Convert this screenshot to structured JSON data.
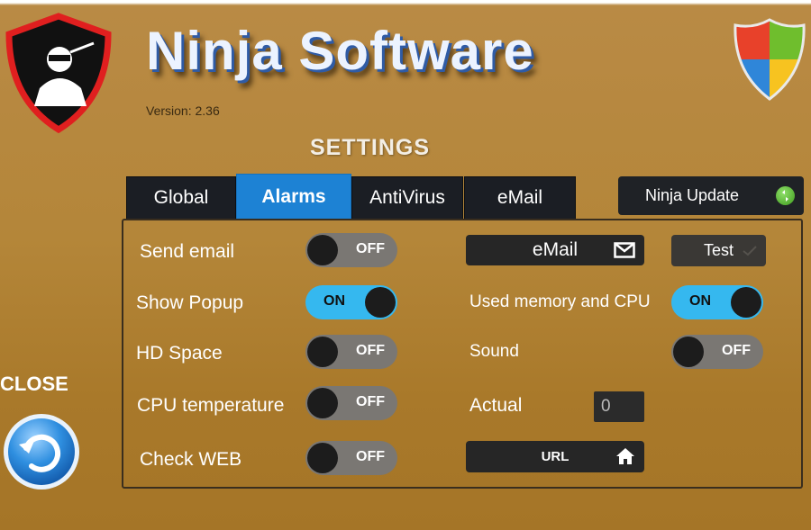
{
  "app": {
    "title": "Ninja Software",
    "version": "Version: 2.36",
    "settings_heading": "SETTINGS"
  },
  "tabs": [
    {
      "label": "Global",
      "active": false
    },
    {
      "label": "Alarms",
      "active": true
    },
    {
      "label": "AntiVirus",
      "active": false
    },
    {
      "label": "eMail",
      "active": false
    }
  ],
  "update_button": {
    "label": "Ninja Update",
    "icon": "refresh-icon"
  },
  "alarms": {
    "send_email": {
      "label": "Send email",
      "state": "OFF"
    },
    "show_popup": {
      "label": "Show Popup",
      "state": "ON"
    },
    "hd_space": {
      "label": "HD Space",
      "state": "OFF"
    },
    "cpu_temperature": {
      "label": "CPU temperature",
      "state": "OFF"
    },
    "check_web": {
      "label": "Check WEB",
      "state": "OFF"
    },
    "used_memory_cpu": {
      "label": "Used memory and CPU",
      "state": "ON"
    },
    "sound": {
      "label": "Sound",
      "state": "OFF"
    },
    "actual": {
      "label": "Actual",
      "value": "0"
    }
  },
  "buttons": {
    "email": "eMail",
    "test": "Test",
    "url": "URL"
  },
  "close": {
    "label": "CLOSE",
    "icon": "undo-arrow-icon"
  },
  "colors": {
    "accent_blue": "#1d82d4",
    "toggle_on": "#35b8ef",
    "toggle_off": "#7a7773",
    "background": "#b48639"
  }
}
